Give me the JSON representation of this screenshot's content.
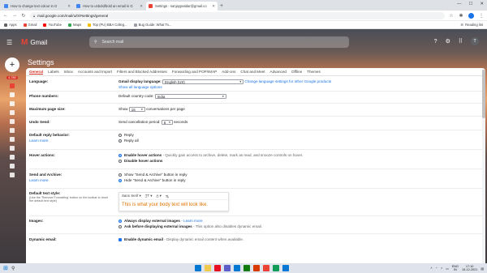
{
  "browser": {
    "tabs": [
      {
        "title": "How to change text colour in G",
        "favicon_color": "#4285f4",
        "active": false
      },
      {
        "title": "How to unbold/bold an email in G",
        "favicon_color": "#4285f4",
        "active": false
      },
      {
        "title": "Settings - sanjaypatidar@gmail.co",
        "favicon_color": "#ea4335",
        "active": true
      }
    ],
    "new_tab_icon": "plus-icon",
    "url": "mail.google.com/mail/u/0/#settings/general",
    "bookmarks": [
      {
        "label": "Apps",
        "color": "#5f6368"
      },
      {
        "label": "Gmail",
        "color": "#ea4335"
      },
      {
        "label": "YouTube",
        "color": "#ff0000"
      },
      {
        "label": "Maps",
        "color": "#34a853"
      },
      {
        "label": "Top (PU) BBA Colleg...",
        "color": "#fbbc04"
      },
      {
        "label": "Bug Guide: What To...",
        "color": "#9aa0a6"
      }
    ],
    "reading_list": "Reading list"
  },
  "gmail": {
    "logo_text": "Gmail",
    "search_placeholder": "Search mail",
    "account_initial": "T",
    "unread_badge": "4,780",
    "settings_title": "Settings",
    "tabs": [
      "General",
      "Labels",
      "Inbox",
      "Accounts and Import",
      "Filters and Blocked Addresses",
      "Forwarding and POP/IMAP",
      "Add-ons",
      "Chat and Meet",
      "Advanced",
      "Offline",
      "Themes"
    ],
    "active_tab": "General",
    "rows": {
      "language": {
        "label": "Language:",
        "display_label": "Gmail display language:",
        "display_value": "English (US)",
        "change_link": "Change language settings for other Google products",
        "options_link": "Show all language options"
      },
      "phone": {
        "label": "Phone numbers:",
        "country_label": "Default country code:",
        "country_value": "India"
      },
      "page_size": {
        "label": "Maximum page size:",
        "show": "Show",
        "value": "15",
        "suffix": "conversations per page"
      },
      "undo_send": {
        "label": "Undo Send:",
        "period_label": "Send cancellation period:",
        "value": "5",
        "suffix": "seconds"
      },
      "reply": {
        "label": "Default reply behavior:",
        "learn_more": "Learn more",
        "options": [
          "Reply",
          "Reply all"
        ]
      },
      "hover": {
        "label": "Hover actions:",
        "on_bold": "Enable hover actions",
        "on_desc": " - Quickly gain access to archive, delete, mark as read, and snooze controls on hover.",
        "off": "Disable hover actions"
      },
      "send_archive": {
        "label": "Send and Archive:",
        "learn_more": "Learn more",
        "options": [
          "Show \"Send & Archive\" button in reply",
          "Hide \"Send & Archive\" button in reply"
        ]
      },
      "text_style": {
        "label": "Default text style:",
        "note": "(Use the 'Remove Formatting' button on the toolbar to reset the default text style)",
        "font": "Sans Serif",
        "sample": "This is what your body text will look like."
      },
      "images": {
        "label": "Images:",
        "opt1_bold": "Always display external images",
        "opt1_link": " - Learn more",
        "opt2_bold": "Ask before displaying external images",
        "opt2_desc": " - This option also disables dynamic email."
      },
      "dynamic": {
        "label": "Dynamic email:",
        "bold": "Enable dynamic email",
        "desc": " - Display dynamic email content when available."
      }
    }
  },
  "taskbar": {
    "apps": [
      "#0078d4",
      "#f2c94c",
      "#e81123",
      "#5b5fc7",
      "#0078d4",
      "#107c10",
      "#d83b01",
      "#ea4335",
      "#0f9d58",
      "#0078d4"
    ],
    "lang": "ENG",
    "region": "IN",
    "time": "17:10",
    "date": "15-12-2021"
  }
}
